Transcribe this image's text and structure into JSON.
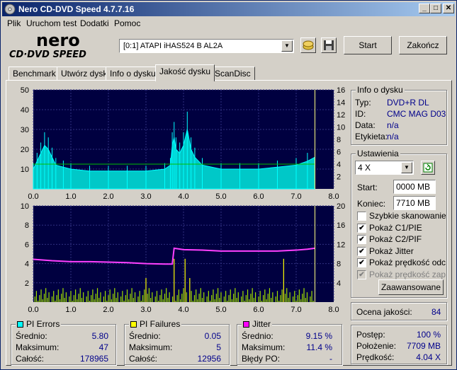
{
  "window": {
    "title": "Nero CD-DVD Speed 4.7.7.16"
  },
  "menu": [
    "Plik",
    "Uruchom test",
    "Dodatki",
    "Pomoc"
  ],
  "logo": {
    "brand": "nero",
    "sub": "CD·DVD SPEED"
  },
  "drive": {
    "selected": "[0:1]   ATAPI iHAS524   B AL2A"
  },
  "toolbar": {
    "start": "Start",
    "close": "Zakończ"
  },
  "tabs": [
    "Benchmark",
    "Utwórz dysk",
    "Info o dysku",
    "Jakość dysku",
    "ScanDisc"
  ],
  "active_tab": "Jakość dysku",
  "disc_info": {
    "title": "Info o dysku",
    "rows": [
      {
        "label": "Typ:",
        "value": "DVD+R DL"
      },
      {
        "label": "ID:",
        "value": "CMC MAG D03"
      },
      {
        "label": "Data:",
        "value": "n/a"
      },
      {
        "label": "Etykieta:",
        "value": "n/a"
      }
    ]
  },
  "settings": {
    "title": "Ustawienia",
    "speed": "4 X",
    "start_label": "Start:",
    "start_value": "0000 MB",
    "end_label": "Koniec:",
    "end_value": "7710 MB",
    "checks": [
      {
        "label": "Szybkie skanowanie",
        "checked": false,
        "disabled": false
      },
      {
        "label": "Pokaż C1/PIE",
        "checked": true,
        "disabled": false
      },
      {
        "label": "Pokaż C2/PIF",
        "checked": true,
        "disabled": false
      },
      {
        "label": "Pokaż Jitter",
        "checked": true,
        "disabled": false
      },
      {
        "label": "Pokaż prędkość odczytu",
        "checked": true,
        "disabled": false
      },
      {
        "label": "Pokaż prędkość zapisu",
        "checked": true,
        "disabled": true
      }
    ],
    "advanced": "Zaawansowane"
  },
  "quality": {
    "label": "Ocena jakości:",
    "value": "84"
  },
  "progress": {
    "rows": [
      {
        "label": "Postęp:",
        "value": "100 %"
      },
      {
        "label": "Położenie:",
        "value": "7709 MB"
      },
      {
        "label": "Prędkość:",
        "value": "4.04 X"
      }
    ]
  },
  "pi_errors": {
    "title": "PI Errors",
    "color": "#00ffff",
    "rows": [
      {
        "label": "Średnio:",
        "value": "5.80"
      },
      {
        "label": "Maksimum:",
        "value": "47"
      },
      {
        "label": "Całość:",
        "value": "178965"
      }
    ]
  },
  "pi_failures": {
    "title": "PI Failures",
    "color": "#ffff00",
    "rows": [
      {
        "label": "Średnio:",
        "value": "0.05"
      },
      {
        "label": "Maksimum:",
        "value": "5"
      },
      {
        "label": "Całość:",
        "value": "12956"
      }
    ]
  },
  "jitter": {
    "title": "Jitter",
    "color": "#ff00ff",
    "rows": [
      {
        "label": "Średnio:",
        "value": "9.15 %"
      },
      {
        "label": "Maksimum:",
        "value": "11.4 %"
      },
      {
        "label": "Błędy PO:",
        "value": "-"
      }
    ]
  },
  "chart_data": [
    {
      "type": "area",
      "title": "PI Errors",
      "x_ticks": [
        "0.0",
        "1.0",
        "2.0",
        "3.0",
        "4.0",
        "5.0",
        "6.0",
        "7.0",
        "8.0"
      ],
      "y_left_ticks": [
        "50",
        "40",
        "30",
        "20",
        "10"
      ],
      "y_right_ticks": [
        "16",
        "14",
        "12",
        "10",
        "8",
        "6",
        "4",
        "2"
      ],
      "xlim": [
        0,
        8
      ],
      "ylim": [
        0,
        50
      ],
      "y2lim": [
        0,
        16
      ],
      "series": [
        {
          "values_x": [
            0,
            0.1,
            0.2,
            0.3,
            0.4,
            0.5,
            0.6,
            0.8,
            1.0,
            1.5,
            2.0,
            2.5,
            3.0,
            3.5,
            3.65,
            3.7,
            3.75,
            3.8,
            3.9,
            4.0,
            4.1,
            4.2,
            4.3,
            4.5,
            5.0,
            5.5,
            6.0,
            6.5,
            7.0,
            7.3,
            7.5
          ],
          "values_y": [
            10,
            14,
            18,
            22,
            20,
            16,
            12,
            11,
            10,
            9,
            9,
            9,
            9,
            10,
            12,
            22,
            26,
            20,
            18,
            22,
            30,
            20,
            16,
            12,
            10,
            10,
            10,
            11,
            12,
            14,
            16
          ]
        },
        {
          "values_x": [
            0,
            7.5
          ],
          "values_y": [
            4,
            4
          ]
        }
      ]
    },
    {
      "type": "bar",
      "title": "PI Failures / Jitter",
      "x_ticks": [
        "0.0",
        "1.0",
        "2.0",
        "3.0",
        "4.0",
        "5.0",
        "6.0",
        "7.0",
        "8.0"
      ],
      "y_left_ticks": [
        "10",
        "8",
        "6",
        "4",
        "2"
      ],
      "y_right_ticks": [
        "20",
        "16",
        "12",
        "8",
        "4"
      ],
      "xlim": [
        0,
        8
      ],
      "ylim": [
        0,
        10
      ],
      "y2lim": [
        0,
        20
      ],
      "series": [
        {
          "values_x": [
            0,
            0.5,
            1.0,
            1.5,
            2.0,
            2.5,
            3.0,
            3.5,
            3.7,
            3.75,
            4.0,
            4.5,
            5.0,
            5.5,
            6.0,
            6.5,
            7.0,
            7.3,
            7.5
          ],
          "values_y": [
            8.9,
            8.6,
            8.4,
            8.4,
            8.3,
            8.2,
            8.0,
            7.9,
            7.9,
            11.2,
            10.9,
            10.8,
            10.6,
            10.6,
            10.6,
            10.6,
            10.8,
            11.0,
            11.2
          ]
        }
      ]
    }
  ]
}
